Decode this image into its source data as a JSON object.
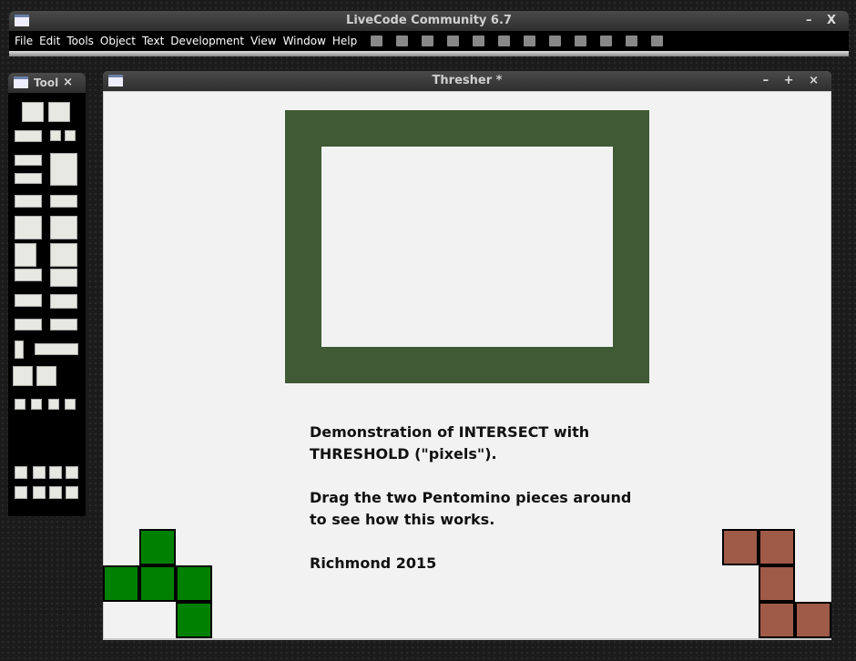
{
  "app": {
    "title": "LiveCode Community 6.7",
    "menus": [
      "File",
      "Edit",
      "Tools",
      "Object",
      "Text",
      "Development",
      "View",
      "Window",
      "Help"
    ],
    "toolbar_icons": [
      "inspector-icon",
      "script-icon",
      "message-box-icon",
      "group-icon",
      "edit-group-icon",
      "select-grouped-icon",
      "messages-icon",
      "errors-icon",
      "dictionary-icon",
      "tutorials-icon",
      "resources-icon",
      "sample-stacks-icon"
    ]
  },
  "tools": {
    "title": "Tool"
  },
  "stack": {
    "title": "Thresher *",
    "message": "Demonstration of INTERSECT with\nTHRESHOLD (\"pixels\").\n\nDrag the two Pentomino pieces around\nto see how this works.\n\nRichmond 2015"
  },
  "colors": {
    "frame": "#3f5a35",
    "green_piece": "#008000",
    "brown_piece": "#a05a48"
  }
}
